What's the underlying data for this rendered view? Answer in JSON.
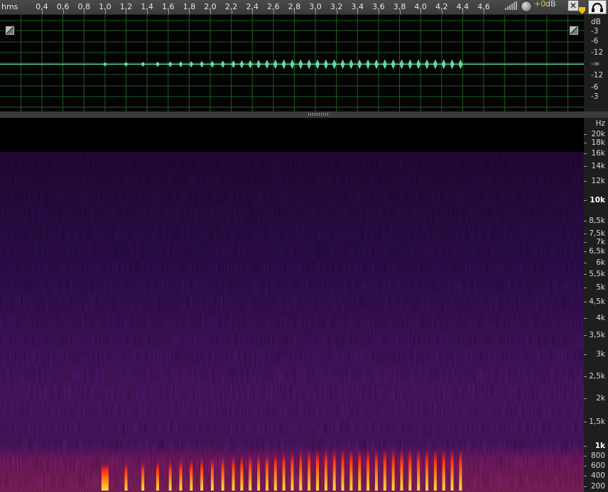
{
  "ruler": {
    "unit": "hms",
    "ticks": [
      "0,4",
      "0,6",
      "0,8",
      "1,0",
      "1,2",
      "1,4",
      "1,6",
      "1,8",
      "2,0",
      "2,2",
      "2,4",
      "2,6",
      "2,8",
      "3,0",
      "3,2",
      "3,4",
      "3,6",
      "3,8",
      "4,0",
      "4,2",
      "4,4",
      "4,6"
    ],
    "tick_values": [
      0.4,
      0.6,
      0.8,
      1.0,
      1.2,
      1.4,
      1.6,
      1.8,
      2.0,
      2.2,
      2.4,
      2.6,
      2.8,
      3.0,
      3.2,
      3.4,
      3.6,
      3.8,
      4.0,
      4.2,
      4.4,
      4.6
    ],
    "tick_anchor_seconds": [
      0.4,
      4.6
    ]
  },
  "controls": {
    "gain_label": "+0",
    "gain_unit": "dB",
    "close_label": "✕",
    "meter_icon": "volume-meter-icon",
    "knob_icon": "gain-knob-icon",
    "headphone_icon": "headphone-icon",
    "playhead_icon": "playhead-marker-icon"
  },
  "waveform": {
    "db_labels": [
      "dB",
      "-3",
      "-6",
      "-12",
      "-∞",
      "-12",
      "-6",
      "-3"
    ],
    "db_label_positions": [
      "top",
      "-3",
      "-6",
      "-12",
      "center",
      "-12b",
      "-6b",
      "-3b"
    ],
    "wave_color": "#5fe0a0",
    "grid_color": "#1f5f1f",
    "onsets_seconds": [
      1.0,
      1.2,
      1.36,
      1.5,
      1.62,
      1.72,
      1.82,
      1.92,
      2.02,
      2.12,
      2.22,
      2.3,
      2.38,
      2.46,
      2.54,
      2.62,
      2.7,
      2.78,
      2.86,
      2.94,
      3.02,
      3.1,
      3.18,
      3.26,
      3.34,
      3.42,
      3.5,
      3.58,
      3.66,
      3.74,
      3.82,
      3.9,
      3.98,
      4.06,
      4.14,
      4.22,
      4.3,
      4.38
    ]
  },
  "spectrogram": {
    "hz_labels": [
      "Hz",
      "20k",
      "18k",
      "16k",
      "14k",
      "12k",
      "10k",
      "8,5k",
      "7,5k",
      "7k",
      "6,5k",
      "6k",
      "5,5k",
      "5k",
      "4,5k",
      "4k",
      "3,5k",
      "3k",
      "2,5k",
      "2k",
      "1,5k",
      "1k",
      "800",
      "600",
      "400",
      "200"
    ],
    "hz_values": [
      null,
      20000,
      18000,
      16000,
      14000,
      12000,
      10000,
      8500,
      7500,
      7000,
      6500,
      6000,
      5500,
      5000,
      4500,
      4000,
      3500,
      3000,
      2500,
      2000,
      1500,
      1000,
      800,
      600,
      400,
      200
    ],
    "bold_labels": [
      "10k",
      "1k"
    ],
    "colors": {
      "background": "#000000",
      "low": "#2a0a44",
      "mid": "#5a1a7a",
      "band": "#8a1e7a",
      "hot": "#ff3010",
      "peak": "#ffe040"
    }
  }
}
